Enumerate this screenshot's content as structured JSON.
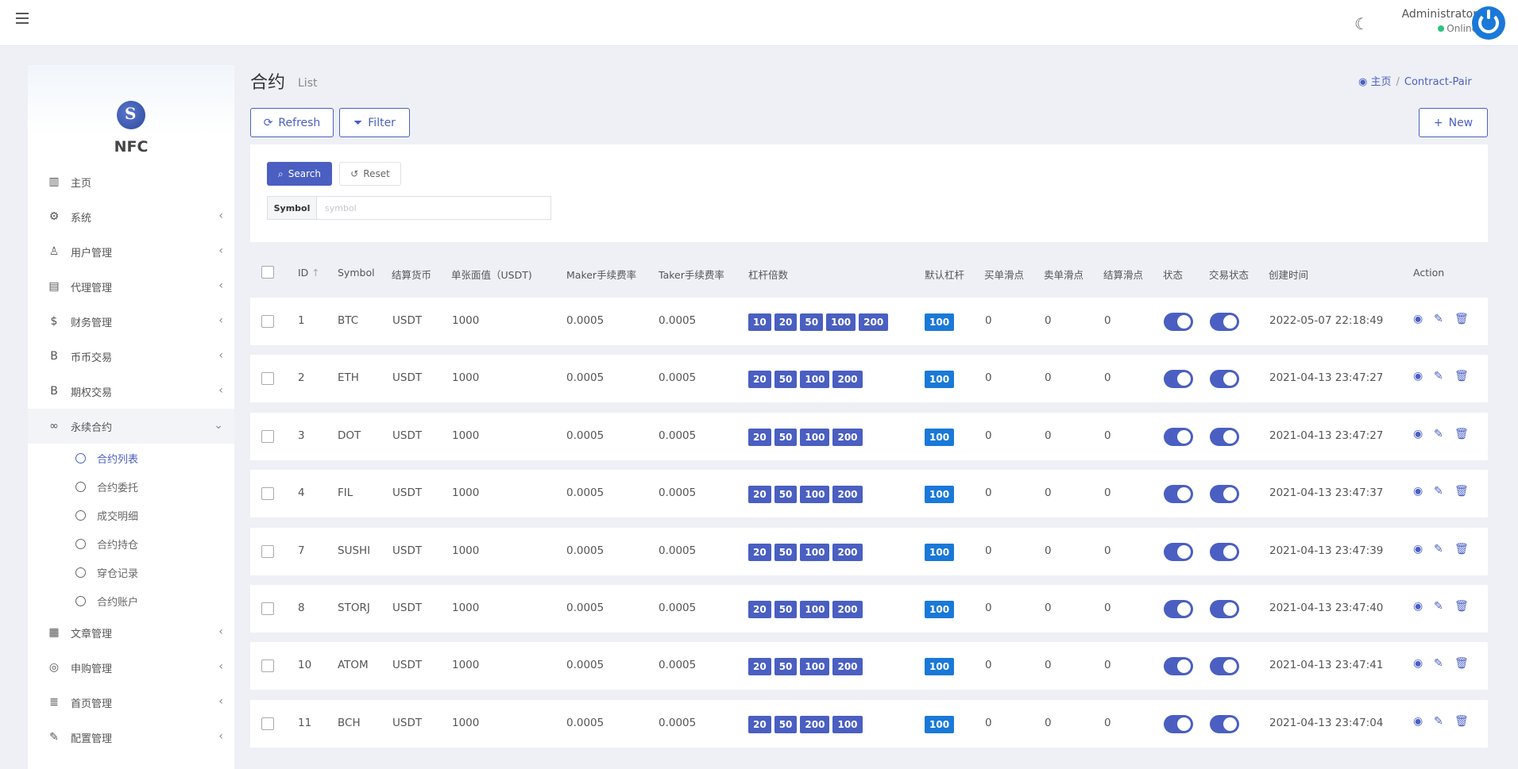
{
  "header": {
    "user_name": "Administrator",
    "user_status": "Online"
  },
  "sidebar": {
    "logo_text": "NFC",
    "items": [
      {
        "label": "主页",
        "icon": "bar-chart-icon",
        "glyph": "▥",
        "chevron": false
      },
      {
        "label": "系统",
        "icon": "gear-icon",
        "glyph": "⚙",
        "chevron": true
      },
      {
        "label": "用户管理",
        "icon": "users-icon",
        "glyph": "♙",
        "chevron": true
      },
      {
        "label": "代理管理",
        "icon": "id-card-icon",
        "glyph": "▤",
        "chevron": true
      },
      {
        "label": "财务管理",
        "icon": "dollar-icon",
        "glyph": "$",
        "chevron": true
      },
      {
        "label": "币币交易",
        "icon": "bitcoin-icon",
        "glyph": "B",
        "chevron": true
      },
      {
        "label": "期权交易",
        "icon": "bitcoin-icon",
        "glyph": "B",
        "chevron": true
      },
      {
        "label": "永续合约",
        "icon": "link-icon",
        "glyph": "∞",
        "chevron": true,
        "expanded": true
      }
    ],
    "sub_items": [
      "合约列表",
      "合约委托",
      "成交明细",
      "合约持仓",
      "穿仓记录",
      "合约账户"
    ],
    "items_after": [
      {
        "label": "文章管理",
        "icon": "newspaper-icon",
        "glyph": "▦",
        "chevron": true
      },
      {
        "label": "申购管理",
        "icon": "lifebuoy-icon",
        "glyph": "◎",
        "chevron": true
      },
      {
        "label": "首页管理",
        "icon": "list-icon",
        "glyph": "≣",
        "chevron": true
      },
      {
        "label": "配置管理",
        "icon": "wrench-icon",
        "glyph": "✎",
        "chevron": true
      }
    ]
  },
  "page": {
    "title": "合约",
    "subtitle": "List"
  },
  "breadcrumb": {
    "home": "主页",
    "current": "Contract-Pair"
  },
  "toolbar": {
    "refresh": "Refresh",
    "filter": "Filter",
    "new": "New"
  },
  "filter": {
    "search": "Search",
    "reset": "Reset",
    "symbol_label": "Symbol",
    "symbol_placeholder": "symbol"
  },
  "table": {
    "headers": {
      "id": "ID",
      "symbol": "Symbol",
      "settle_currency": "结算货币",
      "face_value": "单张面值（USDT)",
      "maker_fee": "Maker手续费率",
      "taker_fee": "Taker手续费率",
      "leverage": "杠杆倍数",
      "default_leverage": "默认杠杆",
      "buy_slippage": "买单滑点",
      "sell_slippage": "卖单滑点",
      "settle_slippage": "结算滑点",
      "status": "状态",
      "trade_status": "交易状态",
      "created": "创建时间",
      "action": "Action"
    },
    "rows": [
      {
        "id": "1",
        "symbol": "BTC",
        "currency": "USDT",
        "face": "1000",
        "maker": "0.0005",
        "taker": "0.0005",
        "leverages": [
          "10",
          "20",
          "50",
          "100",
          "200"
        ],
        "default": "100",
        "buy": "0",
        "sell": "0",
        "settle": "0",
        "created": "2022-05-07 22:18:49"
      },
      {
        "id": "2",
        "symbol": "ETH",
        "currency": "USDT",
        "face": "1000",
        "maker": "0.0005",
        "taker": "0.0005",
        "leverages": [
          "20",
          "50",
          "100",
          "200"
        ],
        "default": "100",
        "buy": "0",
        "sell": "0",
        "settle": "0",
        "created": "2021-04-13 23:47:27"
      },
      {
        "id": "3",
        "symbol": "DOT",
        "currency": "USDT",
        "face": "1000",
        "maker": "0.0005",
        "taker": "0.0005",
        "leverages": [
          "20",
          "50",
          "100",
          "200"
        ],
        "default": "100",
        "buy": "0",
        "sell": "0",
        "settle": "0",
        "created": "2021-04-13 23:47:27"
      },
      {
        "id": "4",
        "symbol": "FIL",
        "currency": "USDT",
        "face": "1000",
        "maker": "0.0005",
        "taker": "0.0005",
        "leverages": [
          "20",
          "50",
          "100",
          "200"
        ],
        "default": "100",
        "buy": "0",
        "sell": "0",
        "settle": "0",
        "created": "2021-04-13 23:47:37"
      },
      {
        "id": "7",
        "symbol": "SUSHI",
        "currency": "USDT",
        "face": "1000",
        "maker": "0.0005",
        "taker": "0.0005",
        "leverages": [
          "20",
          "50",
          "100",
          "200"
        ],
        "default": "100",
        "buy": "0",
        "sell": "0",
        "settle": "0",
        "created": "2021-04-13 23:47:39"
      },
      {
        "id": "8",
        "symbol": "STORJ",
        "currency": "USDT",
        "face": "1000",
        "maker": "0.0005",
        "taker": "0.0005",
        "leverages": [
          "20",
          "50",
          "100",
          "200"
        ],
        "default": "100",
        "buy": "0",
        "sell": "0",
        "settle": "0",
        "created": "2021-04-13 23:47:40"
      },
      {
        "id": "10",
        "symbol": "ATOM",
        "currency": "USDT",
        "face": "1000",
        "maker": "0.0005",
        "taker": "0.0005",
        "leverages": [
          "20",
          "50",
          "100",
          "200"
        ],
        "default": "100",
        "buy": "0",
        "sell": "0",
        "settle": "0",
        "created": "2021-04-13 23:47:41"
      },
      {
        "id": "11",
        "symbol": "BCH",
        "currency": "USDT",
        "face": "1000",
        "maker": "0.0005",
        "taker": "0.0005",
        "leverages": [
          "20",
          "50",
          "200",
          "100"
        ],
        "default": "100",
        "buy": "0",
        "sell": "0",
        "settle": "0",
        "created": "2021-04-13 23:47:04"
      }
    ]
  },
  "colors": {
    "accent": "#4a5fc1",
    "default_badge": "#1a79d8",
    "online": "#2ec27e"
  }
}
